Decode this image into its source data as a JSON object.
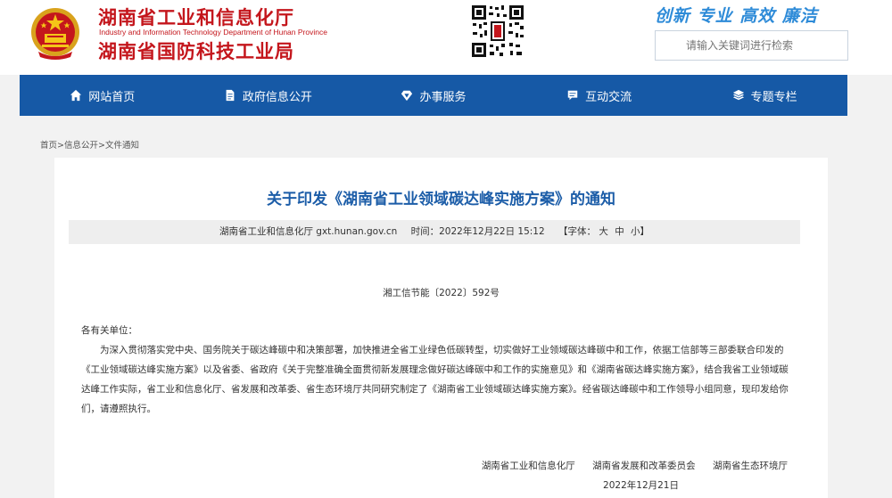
{
  "header": {
    "org_name": "湖南省工业和信息化厅",
    "org_name_en": "Industry and Information Technology Department of Hunan Province",
    "org_name_sub": "湖南省国防科技工业局",
    "slogan": "创新 专业 高效 廉洁",
    "search_placeholder": "请输入关键词进行检索"
  },
  "nav": {
    "items": [
      {
        "label": "网站首页",
        "icon": "home-icon"
      },
      {
        "label": "政府信息公开",
        "icon": "document-icon"
      },
      {
        "label": "办事服务",
        "icon": "diamond-icon"
      },
      {
        "label": "互动交流",
        "icon": "message-icon"
      },
      {
        "label": "专题专栏",
        "icon": "layers-icon"
      }
    ]
  },
  "breadcrumb": {
    "items": [
      "首页",
      "信息公开",
      "文件通知"
    ],
    "separator": ">"
  },
  "article": {
    "title": "关于印发《湖南省工业领域碳达峰实施方案》的通知",
    "source": "湖南省工业和信息化厅 gxt.hunan.gov.cn",
    "time": "时间：2022年12月22日 15:12",
    "font_label": "【字体：",
    "font_sizes": [
      "大",
      "中",
      "小"
    ],
    "font_close": "】",
    "doc_number": "湘工信节能〔2022〕592号",
    "greeting": "各有关单位：",
    "body": "为深入贯彻落实党中央、国务院关于碳达峰碳中和决策部署，加快推进全省工业绿色低碳转型，切实做好工业领域碳达峰碳中和工作，依据工信部等三部委联合印发的《工业领域碳达峰实施方案》以及省委、省政府《关于完整准确全面贯彻新发展理念做好碳达峰碳中和工作的实施意见》和《湖南省碳达峰实施方案》，结合我省工业领域碳达峰工作实际，省工业和信息化厅、省发展和改革委、省生态环境厅共同研究制定了《湖南省工业领域碳达峰实施方案》。经省碳达峰碳中和工作领导小组同意，现印发给你们，请遵照执行。",
    "signers": [
      "湖南省工业和信息化厅",
      "湖南省发展和改革委员会",
      "湖南省生态环境厅"
    ],
    "date": "2022年12月21日"
  },
  "colors": {
    "brand_red": "#c4161c",
    "nav_blue": "#1659a6",
    "title_blue": "#1c5da8",
    "slogan_blue": "#2e8bd8"
  }
}
